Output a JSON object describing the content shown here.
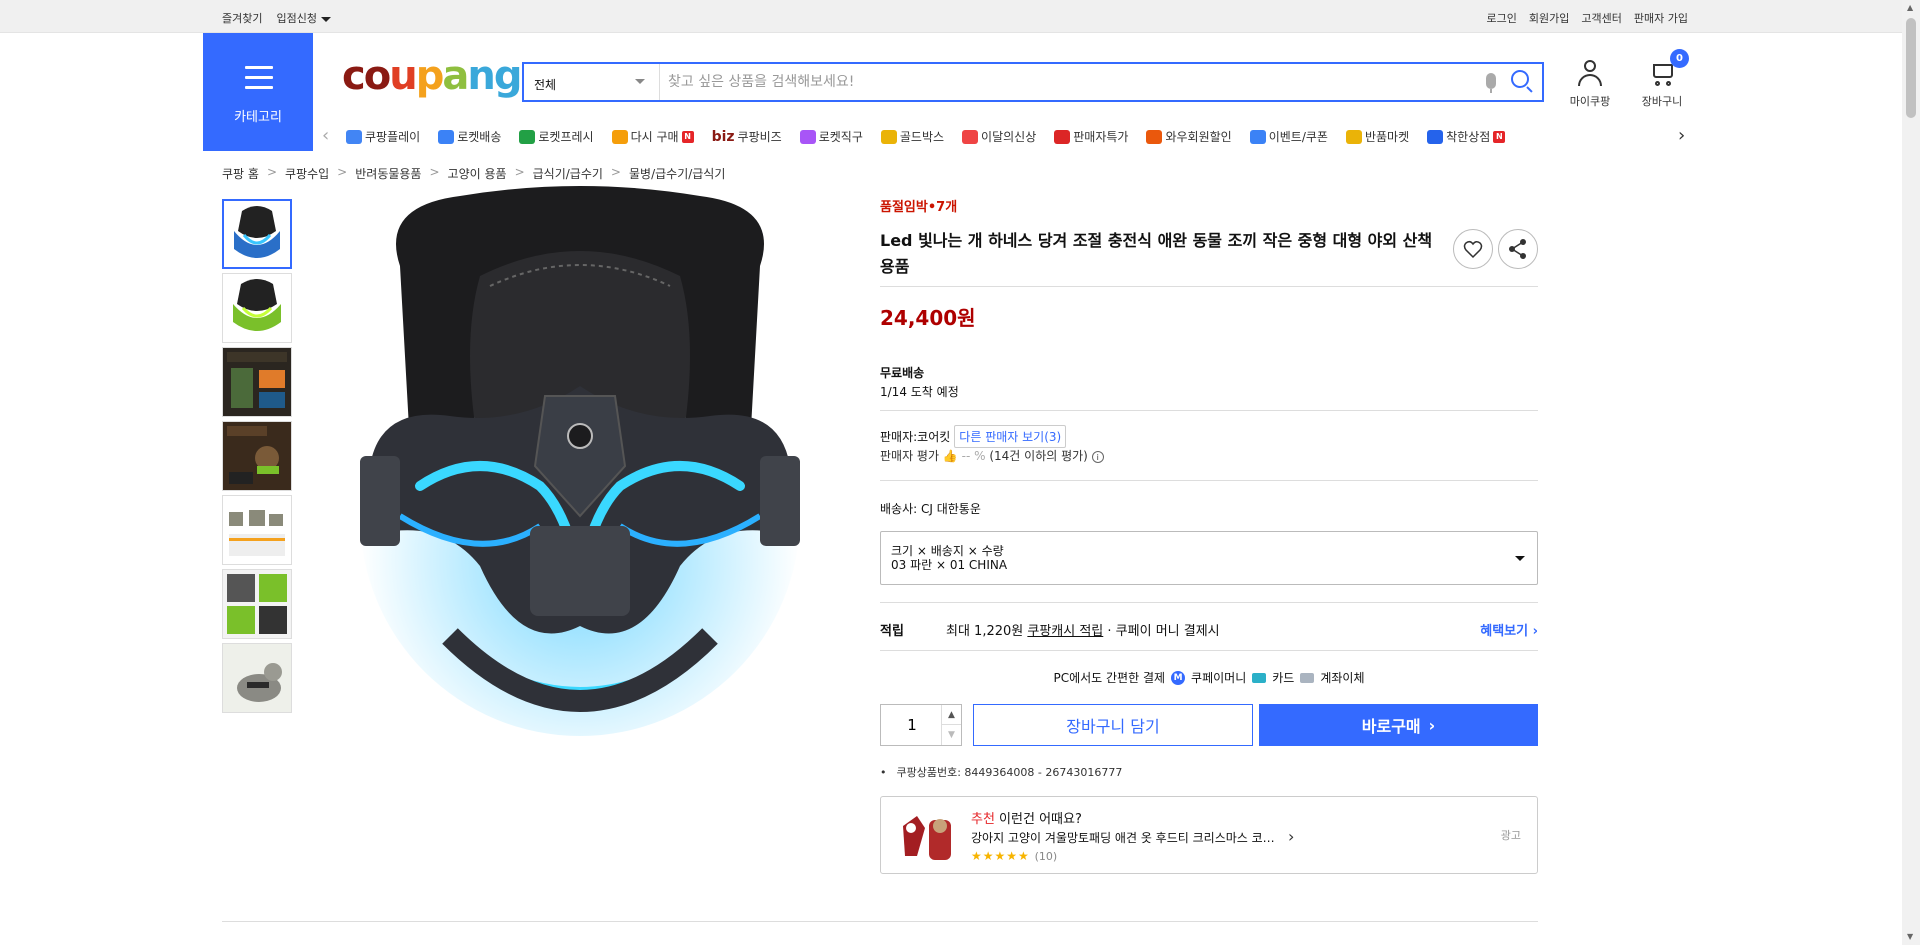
{
  "topbar": {
    "left": [
      "즐겨찾기",
      "입점신청"
    ],
    "right": [
      "로그인",
      "회원가입",
      "고객센터",
      "판매자 가입"
    ]
  },
  "header": {
    "category_label": "카테고리",
    "logo": {
      "letters": [
        "c",
        "o",
        "u",
        "p",
        "a",
        "n",
        "g"
      ],
      "colors": [
        "#8a1a13",
        "#8a1a13",
        "#e03f24",
        "#f4a11d",
        "#8fbf3f",
        "#3aa8da",
        "#3aa8da"
      ]
    },
    "search_scope": "전체",
    "search_placeholder": "찾고 싶은 상품을 검색해보세요!",
    "mycoupang_label": "마이쿠팡",
    "cart_label": "장바구니",
    "cart_count": "0"
  },
  "nav": {
    "items": [
      {
        "label": "쿠팡플레이",
        "icon": "play-icon",
        "color": "#4285f4"
      },
      {
        "label": "로켓배송",
        "icon": "rocket-icon",
        "color": "#3b82f6"
      },
      {
        "label": "로켓프레시",
        "icon": "rocket-fresh-icon",
        "color": "#22a045"
      },
      {
        "label": "다시 구매",
        "icon": "rebuy-icon",
        "color": "#f59e0b",
        "badge": "N"
      },
      {
        "label": "쿠팡비즈",
        "icon": "biz-icon",
        "color": "#8a1a13",
        "prefix": "biz"
      },
      {
        "label": "로켓직구",
        "icon": "direct-icon",
        "color": "#a855f7"
      },
      {
        "label": "골드박스",
        "icon": "goldbox-icon",
        "color": "#eab308"
      },
      {
        "label": "이달의신상",
        "icon": "new-icon",
        "color": "#ef4444"
      },
      {
        "label": "판매자특가",
        "icon": "percent-icon",
        "color": "#dc2626"
      },
      {
        "label": "와우회원할인",
        "icon": "wow-icon",
        "color": "#ea580c"
      },
      {
        "label": "이벤트/쿠폰",
        "icon": "coupon-icon",
        "color": "#3b82f6"
      },
      {
        "label": "반품마켓",
        "icon": "market-icon",
        "color": "#eab308"
      },
      {
        "label": "착한상점",
        "icon": "shop-icon",
        "color": "#2563eb",
        "badge": "N"
      }
    ]
  },
  "breadcrumb": [
    "쿠팡 홈",
    "쿠팡수입",
    "반려동물용품",
    "고양이 용품",
    "급식기/급수기",
    "물병/급수기/급식기"
  ],
  "product": {
    "low_stock": "품절임박•7개",
    "title": "Led 빛나는 개 하네스 당겨 조절 충전식 애완 동물 조끼 작은 중형 대형 야외 산책 용품",
    "price": "24,400원",
    "shipping_title": "무료배송",
    "arrival": "1/14 도착 예정",
    "seller_label": "판매자:코어킷",
    "other_sellers": "다른 판매자 보기(3)",
    "seller_rating_label": "판매자 평가",
    "seller_rating_value": "-- %",
    "seller_rating_note": "(14건 이하의 평가)",
    "carrier": "배송사:  CJ 대한통운",
    "option_header": "크기 × 배송지 × 수량",
    "option_value": "03 파란 × 01 CHINA",
    "reward_key": "적립",
    "reward_prefix": "최대 1,220원",
    "reward_link": "쿠팡캐시 적립",
    "reward_suffix": "· 쿠페이 머니 결제시",
    "reward_more": "혜택보기 ›",
    "pay_title": "PC에서도 간편한 결제",
    "pay_methods": [
      "쿠페이머니",
      "카드",
      "계좌이체"
    ],
    "quantity": "1",
    "add_cart": "장바구니 담기",
    "buy_now": "바로구매",
    "product_no": "쿠팡상품번호: 8449364008 - 26743016777"
  },
  "recommend": {
    "title_accent": "추천",
    "title": " 이런건 어때요?",
    "item": "강아지 고양이 겨울망토패딩 애견 옷 후드티 크리스마스 코스튬",
    "stars": "★★★★★",
    "review_count": "(10)",
    "ad_label": "광고"
  },
  "colors": {
    "accent": "#346aff",
    "price": "#ae0000",
    "stock": "#cb1400"
  }
}
